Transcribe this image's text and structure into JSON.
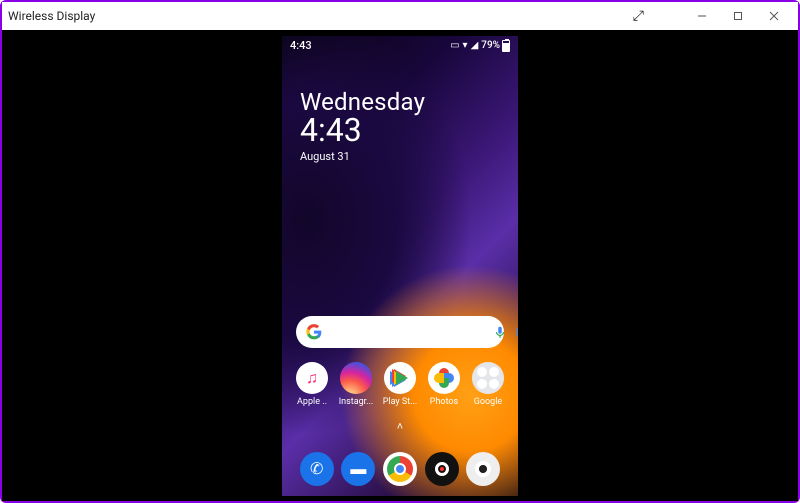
{
  "window": {
    "title": "Wireless Display"
  },
  "status": {
    "time": "4:43",
    "battery_pct": "79%"
  },
  "clock_widget": {
    "day": "Wednesday",
    "time": "4:43",
    "date": "August 31"
  },
  "search": {
    "placeholder": ""
  },
  "apps": [
    {
      "label": "Apple ..",
      "name": "apple-music"
    },
    {
      "label": "Instagr...",
      "name": "instagram"
    },
    {
      "label": "Play St...",
      "name": "play-store"
    },
    {
      "label": "Photos",
      "name": "photos"
    },
    {
      "label": "Google",
      "name": "google-folder"
    }
  ],
  "dock": [
    {
      "name": "phone"
    },
    {
      "name": "messages"
    },
    {
      "name": "chrome"
    },
    {
      "name": "recorder"
    },
    {
      "name": "camera"
    }
  ]
}
